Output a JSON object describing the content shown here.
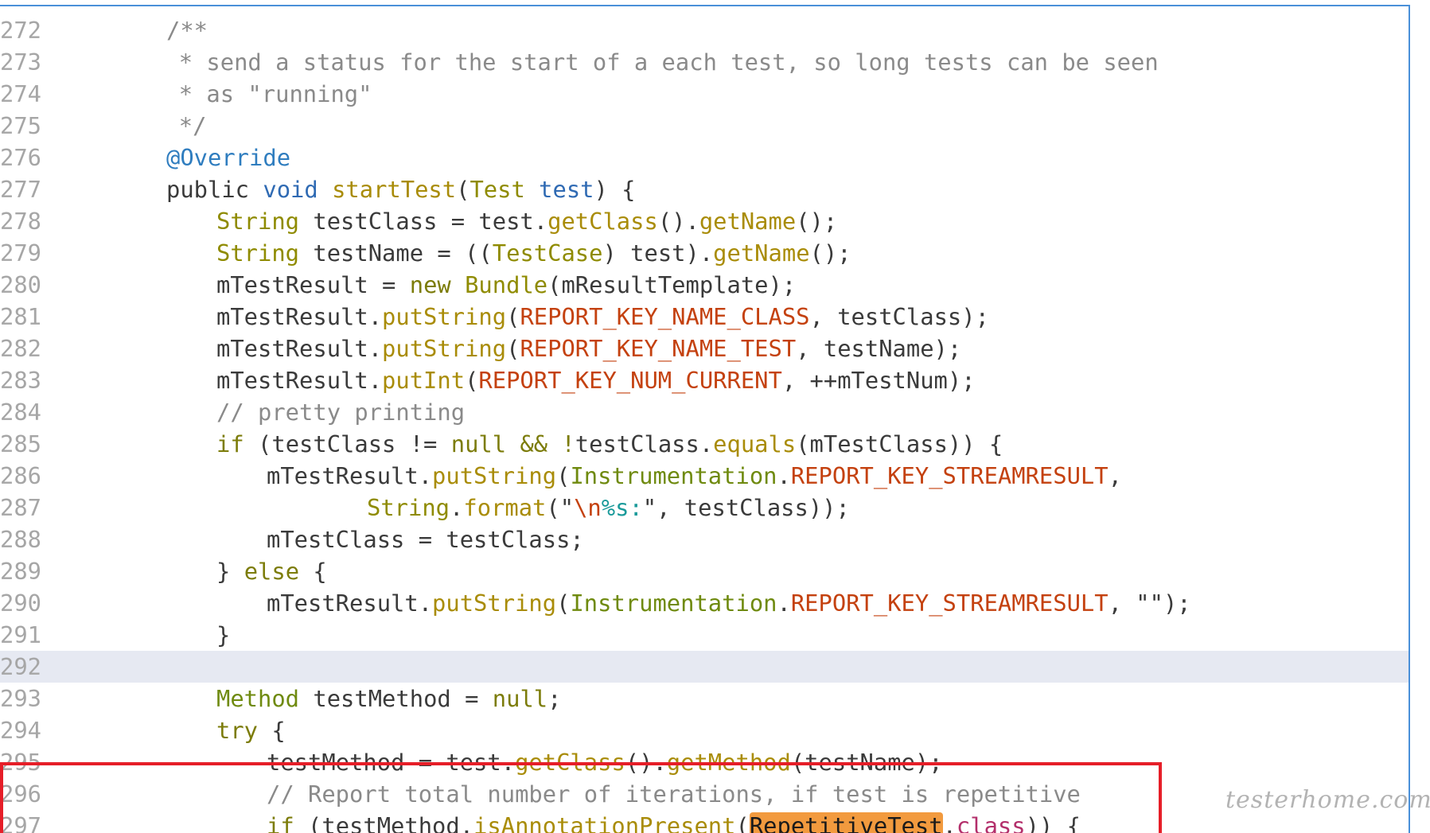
{
  "editor": {
    "highlight_color": "#e6e9f2",
    "callout_color": "#e61e28",
    "search_match_color": "#f29a3e"
  },
  "watermark": "testerhome.com",
  "lines": [
    {
      "n": "272",
      "indent": 12,
      "tokens": [
        {
          "t": "/**",
          "c": "comment"
        }
      ]
    },
    {
      "n": "273",
      "indent": 13,
      "tokens": [
        {
          "t": "* send a status for the start of a each test, so long tests can be seen",
          "c": "comment"
        }
      ]
    },
    {
      "n": "274",
      "indent": 13,
      "tokens": [
        {
          "t": "* as \"running\"",
          "c": "comment"
        }
      ]
    },
    {
      "n": "275",
      "indent": 13,
      "tokens": [
        {
          "t": "*/",
          "c": "comment"
        }
      ]
    },
    {
      "n": "276",
      "indent": 12,
      "tokens": [
        {
          "t": "@Override",
          "c": "annotation"
        }
      ]
    },
    {
      "n": "277",
      "indent": 12,
      "tokens": [
        {
          "t": "public ",
          "c": "ident"
        },
        {
          "t": "void ",
          "c": "param"
        },
        {
          "t": "startTest",
          "c": "method"
        },
        {
          "t": "(",
          "c": "ident"
        },
        {
          "t": "Test ",
          "c": "type"
        },
        {
          "t": "test",
          "c": "param"
        },
        {
          "t": ") {",
          "c": "ident"
        }
      ]
    },
    {
      "n": "278",
      "indent": 16,
      "tokens": [
        {
          "t": "String ",
          "c": "type"
        },
        {
          "t": "testClass = test.",
          "c": "ident"
        },
        {
          "t": "getClass",
          "c": "method"
        },
        {
          "t": "().",
          "c": "ident"
        },
        {
          "t": "getName",
          "c": "method"
        },
        {
          "t": "();",
          "c": "ident"
        }
      ]
    },
    {
      "n": "279",
      "indent": 16,
      "tokens": [
        {
          "t": "String ",
          "c": "type"
        },
        {
          "t": "testName = ((",
          "c": "ident"
        },
        {
          "t": "TestCase",
          "c": "type"
        },
        {
          "t": ") test).",
          "c": "ident"
        },
        {
          "t": "getName",
          "c": "method"
        },
        {
          "t": "();",
          "c": "ident"
        }
      ]
    },
    {
      "n": "280",
      "indent": 16,
      "tokens": [
        {
          "t": "mTestResult = ",
          "c": "ident"
        },
        {
          "t": "new ",
          "c": "keyword"
        },
        {
          "t": "Bundle",
          "c": "type"
        },
        {
          "t": "(mResultTemplate);",
          "c": "ident"
        }
      ]
    },
    {
      "n": "281",
      "indent": 16,
      "tokens": [
        {
          "t": "mTestResult.",
          "c": "ident"
        },
        {
          "t": "putString",
          "c": "method"
        },
        {
          "t": "(",
          "c": "ident"
        },
        {
          "t": "REPORT_KEY_NAME_CLASS",
          "c": "const"
        },
        {
          "t": ", testClass);",
          "c": "ident"
        }
      ]
    },
    {
      "n": "282",
      "indent": 16,
      "tokens": [
        {
          "t": "mTestResult.",
          "c": "ident"
        },
        {
          "t": "putString",
          "c": "method"
        },
        {
          "t": "(",
          "c": "ident"
        },
        {
          "t": "REPORT_KEY_NAME_TEST",
          "c": "const"
        },
        {
          "t": ", testName);",
          "c": "ident"
        }
      ]
    },
    {
      "n": "283",
      "indent": 16,
      "tokens": [
        {
          "t": "mTestResult.",
          "c": "ident"
        },
        {
          "t": "putInt",
          "c": "method"
        },
        {
          "t": "(",
          "c": "ident"
        },
        {
          "t": "REPORT_KEY_NUM_CURRENT",
          "c": "const"
        },
        {
          "t": ", ++mTestNum);",
          "c": "ident"
        }
      ]
    },
    {
      "n": "284",
      "indent": 16,
      "tokens": [
        {
          "t": "// pretty printing",
          "c": "comment"
        }
      ]
    },
    {
      "n": "285",
      "indent": 16,
      "tokens": [
        {
          "t": "if ",
          "c": "keyword"
        },
        {
          "t": "(testClass != ",
          "c": "ident"
        },
        {
          "t": "null ",
          "c": "keyword"
        },
        {
          "t": "&& !",
          "c": "keyword"
        },
        {
          "t": "testClass.",
          "c": "ident"
        },
        {
          "t": "equals",
          "c": "method"
        },
        {
          "t": "(mTestClass)) {",
          "c": "ident"
        }
      ]
    },
    {
      "n": "286",
      "indent": 20,
      "tokens": [
        {
          "t": "mTestResult.",
          "c": "ident"
        },
        {
          "t": "putString",
          "c": "method"
        },
        {
          "t": "(",
          "c": "ident"
        },
        {
          "t": "Instrumentation",
          "c": "class"
        },
        {
          "t": ".",
          "c": "ident"
        },
        {
          "t": "REPORT_KEY_STREAMRESULT",
          "c": "const"
        },
        {
          "t": ",",
          "c": "ident"
        }
      ]
    },
    {
      "n": "287",
      "indent": 28,
      "tokens": [
        {
          "t": "String",
          "c": "type"
        },
        {
          "t": ".",
          "c": "ident"
        },
        {
          "t": "format",
          "c": "method"
        },
        {
          "t": "(\"",
          "c": "ident"
        },
        {
          "t": "\\n",
          "c": "escape"
        },
        {
          "t": "%s:",
          "c": "format"
        },
        {
          "t": "\", testClass));",
          "c": "ident"
        }
      ]
    },
    {
      "n": "288",
      "indent": 20,
      "tokens": [
        {
          "t": "mTestClass = testClass;",
          "c": "ident"
        }
      ]
    },
    {
      "n": "289",
      "indent": 16,
      "tokens": [
        {
          "t": "} ",
          "c": "ident"
        },
        {
          "t": "else ",
          "c": "keyword"
        },
        {
          "t": "{",
          "c": "ident"
        }
      ]
    },
    {
      "n": "290",
      "indent": 20,
      "tokens": [
        {
          "t": "mTestResult.",
          "c": "ident"
        },
        {
          "t": "putString",
          "c": "method"
        },
        {
          "t": "(",
          "c": "ident"
        },
        {
          "t": "Instrumentation",
          "c": "class"
        },
        {
          "t": ".",
          "c": "ident"
        },
        {
          "t": "REPORT_KEY_STREAMRESULT",
          "c": "const"
        },
        {
          "t": ", \"\");",
          "c": "ident"
        }
      ]
    },
    {
      "n": "291",
      "indent": 16,
      "tokens": [
        {
          "t": "}",
          "c": "ident"
        }
      ]
    },
    {
      "n": "292",
      "indent": 0,
      "current": true,
      "tokens": []
    },
    {
      "n": "293",
      "indent": 16,
      "tokens": [
        {
          "t": "Method ",
          "c": "class"
        },
        {
          "t": "testMethod = ",
          "c": "ident"
        },
        {
          "t": "null",
          "c": "keyword"
        },
        {
          "t": ";",
          "c": "ident"
        }
      ]
    },
    {
      "n": "294",
      "indent": 16,
      "tokens": [
        {
          "t": "try ",
          "c": "keyword"
        },
        {
          "t": "{",
          "c": "ident"
        }
      ]
    },
    {
      "n": "295",
      "indent": 20,
      "tokens": [
        {
          "t": "testMethod = test.",
          "c": "ident"
        },
        {
          "t": "getClass",
          "c": "method"
        },
        {
          "t": "().",
          "c": "ident"
        },
        {
          "t": "getMethod",
          "c": "method"
        },
        {
          "t": "(testName);",
          "c": "ident"
        }
      ]
    },
    {
      "n": "296",
      "indent": 20,
      "tokens": [
        {
          "t": "// Report total number of iterations, if test is repetitive",
          "c": "comment"
        }
      ]
    },
    {
      "n": "297",
      "indent": 20,
      "tokens": [
        {
          "t": "if ",
          "c": "keyword"
        },
        {
          "t": "(testMethod.",
          "c": "ident"
        },
        {
          "t": "isAnnotationPresent",
          "c": "method"
        },
        {
          "t": "(",
          "c": "ident"
        },
        {
          "t": "RepetitiveTest",
          "c": "highlight"
        },
        {
          "t": ".",
          "c": "ident"
        },
        {
          "t": "class",
          "c": "class-literal"
        },
        {
          "t": ")) {",
          "c": "ident"
        }
      ]
    }
  ]
}
